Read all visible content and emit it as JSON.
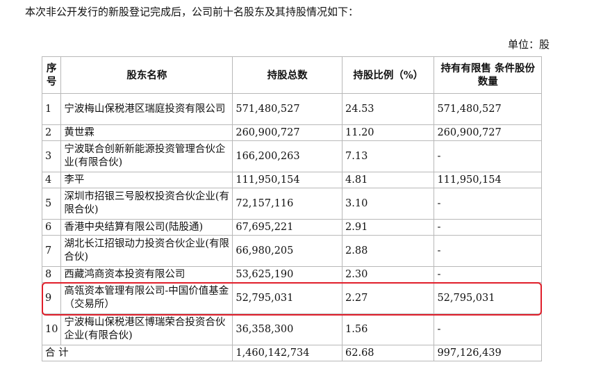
{
  "intro": "本次非公开发行的新股登记完成后，公司前十名股东及其持股情况如下：",
  "unit": "单位：股",
  "headers": {
    "no": "序号",
    "name": "股东名称",
    "total": "持股总数",
    "ratio": "持股比例（%）",
    "limited": "持有有限售 条件股份数量"
  },
  "rows": [
    {
      "no": "1",
      "name": "宁波梅山保税港区瑞庭投资有限公司",
      "total": "571,480,527",
      "ratio": "24.53",
      "limited": "571,480,527"
    },
    {
      "no": "2",
      "name": "黄世霖",
      "total": "260,900,727",
      "ratio": "11.20",
      "limited": "260,900,727"
    },
    {
      "no": "3",
      "name": "宁波联合创新新能源投资管理合伙企业(有限合伙)",
      "total": "166,200,263",
      "ratio": "7.13",
      "limited": "-"
    },
    {
      "no": "4",
      "name": "李平",
      "total": "111,950,154",
      "ratio": "4.81",
      "limited": "111,950,154"
    },
    {
      "no": "5",
      "name": "深圳市招银三号股权投资合伙企业(有限合伙)",
      "total": "72,157,116",
      "ratio": "3.10",
      "limited": "-"
    },
    {
      "no": "6",
      "name": "香港中央结算有限公司(陆股通)",
      "total": "67,695,221",
      "ratio": "2.91",
      "limited": "-"
    },
    {
      "no": "7",
      "name": "湖北长江招银动力投资合伙企业(有限合伙)",
      "total": "66,980,205",
      "ratio": "2.88",
      "limited": "-"
    },
    {
      "no": "8",
      "name": "西藏鸿商资本投资有限公司",
      "total": "53,625,190",
      "ratio": "2.30",
      "limited": "-"
    },
    {
      "no": "9",
      "name": "高瓴资本管理有限公司-中国价值基金（交易所）",
      "total": "52,795,031",
      "ratio": "2.27",
      "limited": "52,795,031"
    },
    {
      "no": "10",
      "name": "宁波梅山保税港区博瑞荣合投资合伙企业(有限合伙)",
      "total": "36,358,300",
      "ratio": "1.56",
      "limited": "-"
    }
  ],
  "total": {
    "label": "合 计",
    "total": "1,460,142,734",
    "ratio": "62.68",
    "limited": "997,126,439"
  },
  "colors": {
    "highlight_border": "#e01e2a",
    "grid": "#b8b8b8"
  }
}
